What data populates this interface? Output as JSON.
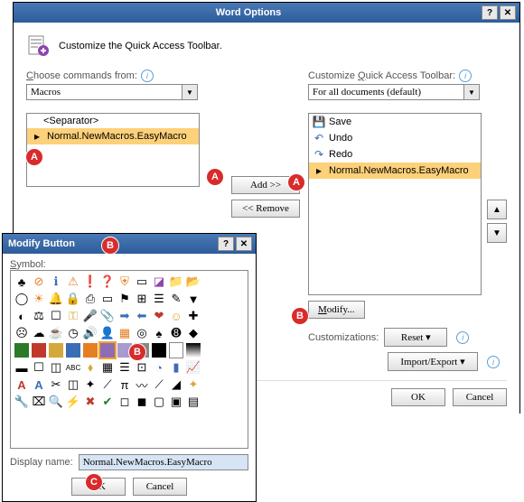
{
  "main": {
    "title": "Word Options",
    "header": "Customize the Quick Access Toolbar.",
    "left_label": "Choose commands from:",
    "left_combo": "Macros",
    "right_label": "Customize Quick Access Toolbar:",
    "right_combo": "For all documents (default)",
    "left_list": {
      "sep": "<Separator>",
      "macro": "Normal.NewMacros.EasyMacro"
    },
    "right_list": {
      "save": "Save",
      "undo": "Undo",
      "redo": "Redo",
      "macro": "Normal.NewMacros.EasyMacro"
    },
    "add": "Add >>",
    "remove": "<< Remove",
    "modify": "Modify...",
    "cust_label": "Customizations:",
    "reset": "Reset ▾",
    "import": "Import/Export ▾",
    "ok": "OK",
    "cancel": "Cancel"
  },
  "modify": {
    "title": "Modify Button",
    "symbol_label": "Symbol:",
    "display_label": "Display name:",
    "display_value": "Normal.NewMacros.EasyMacro",
    "ok": "OK",
    "cancel": "Cancel"
  },
  "badges": {
    "a": "A",
    "b": "B",
    "c": "C"
  }
}
